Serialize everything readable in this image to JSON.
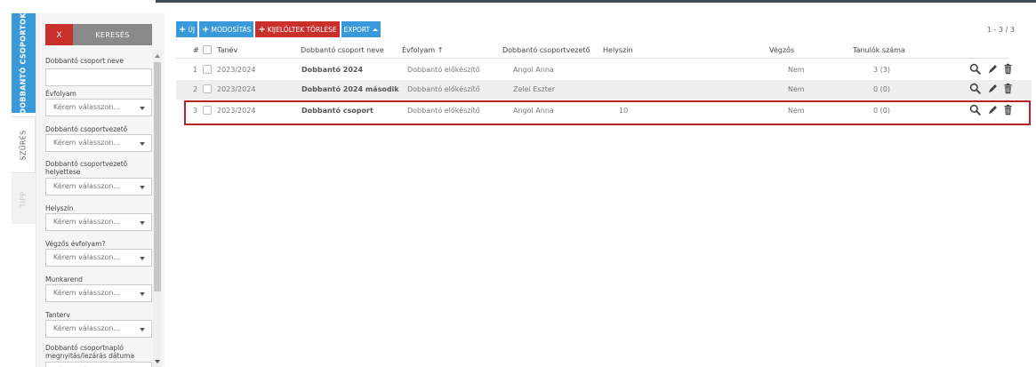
{
  "side_tabs": {
    "main": "DOBBANTÓ CSOPORTOK",
    "filter": "SZŰRÉS",
    "third": "TIPP"
  },
  "filter": {
    "clear_label": "X",
    "search_label": "KERESÉS",
    "placeholder": "Kérem válasszon...",
    "fields": [
      {
        "label": "Dobbantó csoport neve",
        "type": "input"
      },
      {
        "label": "Évfolyam",
        "type": "select"
      },
      {
        "label": "Dobbantó csoportvezető",
        "type": "select"
      },
      {
        "label": "Dobbantó csoportvezető helyettese",
        "type": "select"
      },
      {
        "label": "Helyszín",
        "type": "select"
      },
      {
        "label": "Végzős évfolyam?",
        "type": "select"
      },
      {
        "label": "Munkarend",
        "type": "select"
      },
      {
        "label": "Tanterv",
        "type": "select"
      },
      {
        "label": "Dobbantó csoportnapló megnyitás/lezárás dátuma",
        "type": "select"
      }
    ]
  },
  "toolbar": {
    "new_label": "ÚJ",
    "edit_label": "MÓDOSÍTÁS",
    "delete_label": "KIJELÖLTEK TÖRLÉSE",
    "export_label": "EXPORT"
  },
  "pager": "1 - 3 / 3",
  "table": {
    "columns": {
      "num": "#",
      "year": "Tanév",
      "name": "Dobbantó csoport neve",
      "grade": "Évfolyam",
      "sort_arrow": "↑",
      "leader": "Dobbantó csoportvezető",
      "location": "Helyszín",
      "graduating": "Végzős",
      "students": "Tanulók száma"
    },
    "rows": [
      {
        "num": "1",
        "year": "2023/2024",
        "name": "Dobbantó 2024",
        "grade": "Dobbantó előkészítő",
        "leader": "Angol Anna",
        "location": "",
        "graduating": "Nem",
        "students": "3 (3)"
      },
      {
        "num": "2",
        "year": "2023/2024",
        "name": "Dobbantó 2024 második",
        "grade": "Dobbantó előkészítő",
        "leader": "Zelei Eszter",
        "location": "",
        "graduating": "Nem",
        "students": "0 (0)"
      },
      {
        "num": "3",
        "year": "2023/2024",
        "name": "Dobbantó csoport",
        "grade": "Dobbantó előkészítő",
        "leader": "Angol Anna",
        "location": "10",
        "graduating": "Nem",
        "students": "0 (0)"
      }
    ]
  },
  "icons": {
    "view": "magnifier-icon",
    "edit": "pencil-icon",
    "delete": "trash-icon"
  },
  "colors": {
    "primary": "#3a9ad9",
    "danger": "#c9302c",
    "highlight": "#b8202a"
  }
}
